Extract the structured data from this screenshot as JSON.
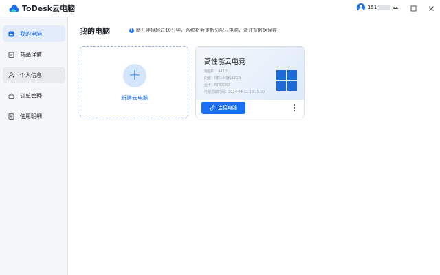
{
  "app": {
    "logo_text": "ToDesk云电脑",
    "user_number": "151",
    "controls": [
      "minimize-icon",
      "maximize-icon",
      "close-icon"
    ]
  },
  "sidebar": {
    "items": [
      {
        "label": "我的电脑",
        "icon": "cloud-icon",
        "active": true
      },
      {
        "label": "商品详情",
        "icon": "clipboard-icon",
        "active": false
      },
      {
        "label": "个人信息",
        "icon": "user-icon",
        "active": false
      },
      {
        "label": "订单管理",
        "icon": "bag-icon",
        "active": false
      },
      {
        "label": "使用明细",
        "icon": "list-icon",
        "active": false
      }
    ]
  },
  "main": {
    "title": "我的电脑",
    "notice": "断开连接超过10分钟，系统将会重新分配云电脑，请注意数据保存",
    "new_card": {
      "label": "新建云电脑"
    },
    "pc_card": {
      "name": "高性能云电竞",
      "specs": {
        "pc_id": "电脑ID：4430",
        "config": "配置：8核16线程32GB",
        "gpu": "显卡：RTX3060",
        "expire": "电脑过期时间：2024-04-11 18:15:00"
      },
      "connect_label": "连接电脑"
    }
  },
  "colors": {
    "accent": "#1b6ff5",
    "sidebar_bg": "#f6f7f9",
    "active_bg": "#e3ecfb"
  }
}
